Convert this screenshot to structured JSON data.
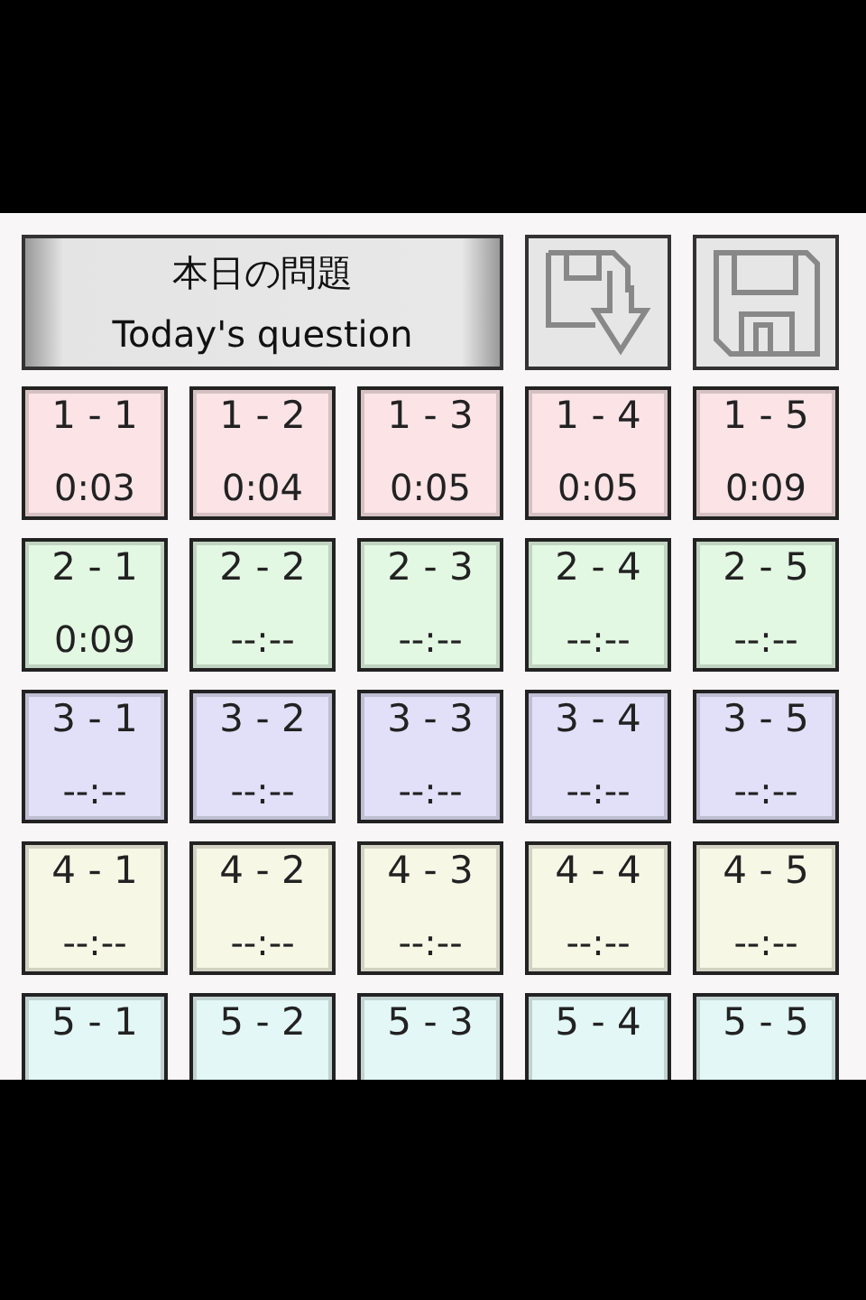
{
  "header": {
    "title": "本日の問題",
    "subtitle": "Today's question"
  },
  "rows": [
    {
      "color": "#fbe3e6",
      "tiles": [
        {
          "label": "1 - 1",
          "time": "0:03"
        },
        {
          "label": "1 - 2",
          "time": "0:04"
        },
        {
          "label": "1 - 3",
          "time": "0:05"
        },
        {
          "label": "1 - 4",
          "time": "0:05"
        },
        {
          "label": "1 - 5",
          "time": "0:09"
        }
      ]
    },
    {
      "color": "#e3f8e3",
      "tiles": [
        {
          "label": "2 - 1",
          "time": "0:09"
        },
        {
          "label": "2 - 2",
          "time": "--:--"
        },
        {
          "label": "2 - 3",
          "time": "--:--"
        },
        {
          "label": "2 - 4",
          "time": "--:--"
        },
        {
          "label": "2 - 5",
          "time": "--:--"
        }
      ]
    },
    {
      "color": "#e2e0f8",
      "tiles": [
        {
          "label": "3 - 1",
          "time": "--:--"
        },
        {
          "label": "3 - 2",
          "time": "--:--"
        },
        {
          "label": "3 - 3",
          "time": "--:--"
        },
        {
          "label": "3 - 4",
          "time": "--:--"
        },
        {
          "label": "3 - 5",
          "time": "--:--"
        }
      ]
    },
    {
      "color": "#f7f7e6",
      "tiles": [
        {
          "label": "4 - 1",
          "time": "--:--"
        },
        {
          "label": "4 - 2",
          "time": "--:--"
        },
        {
          "label": "4 - 3",
          "time": "--:--"
        },
        {
          "label": "4 - 4",
          "time": "--:--"
        },
        {
          "label": "4 - 5",
          "time": "--:--"
        }
      ]
    },
    {
      "color": "#e3f7f6",
      "tiles": [
        {
          "label": "5 - 1"
        },
        {
          "label": "5 - 2"
        },
        {
          "label": "5 - 3"
        },
        {
          "label": "5 - 4"
        },
        {
          "label": "5 - 5"
        }
      ]
    }
  ]
}
